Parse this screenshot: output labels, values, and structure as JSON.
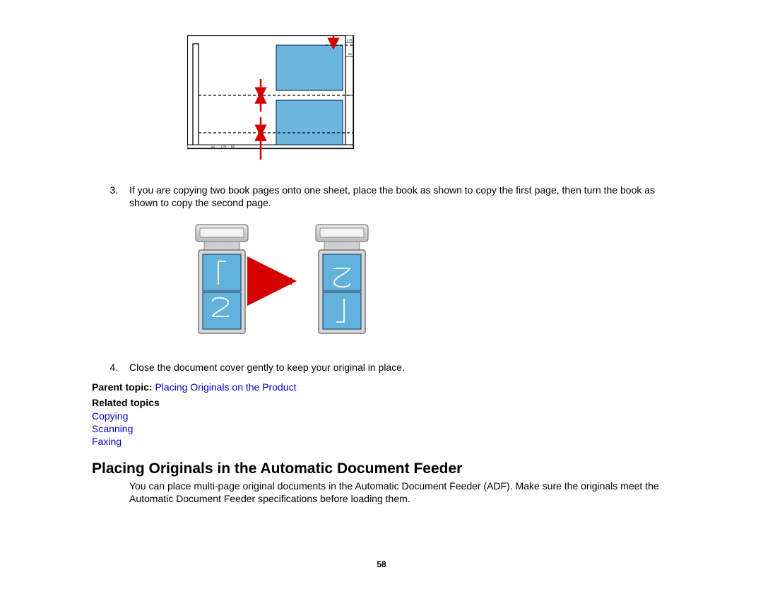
{
  "step3": {
    "num": "3.",
    "text": "If you are copying two book pages onto one sheet, place the book as shown to copy the first page, then turn the book as shown to copy the second page."
  },
  "step4": {
    "num": "4.",
    "text": "Close the document cover gently to keep your original in place."
  },
  "parentTopic": {
    "label": "Parent topic:",
    "linkText": "Placing Originals on the Product"
  },
  "relatedTopics": {
    "heading": "Related topics",
    "items": [
      "Copying",
      "Scanning",
      "Faxing"
    ]
  },
  "sectionHeading": "Placing Originals in the Automatic Document Feeder",
  "sectionBody": "You can place multi-page original documents in the Automatic Document Feeder (ADF). Make sure the originals meet the Automatic Document Feeder specifications before loading them.",
  "pageNumber": "58",
  "figure1": {
    "scaleMarks": [
      "LTR",
      "A4",
      "B5"
    ]
  },
  "figure2": {
    "labels": [
      "1",
      "2"
    ]
  }
}
